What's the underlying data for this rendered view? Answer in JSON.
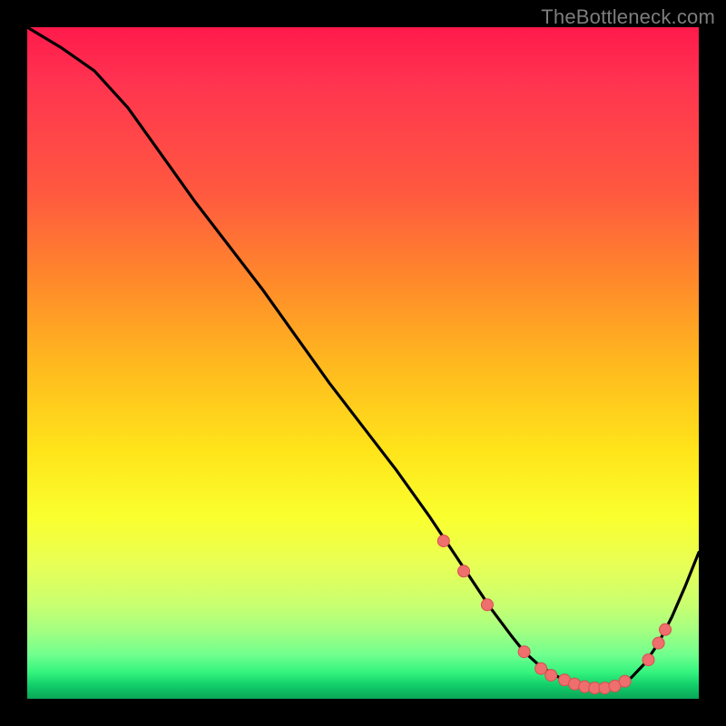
{
  "watermark": "TheBottleneck.com",
  "colors": {
    "curve": "#000000",
    "marker_fill": "#ef6e6e",
    "marker_stroke": "#d74f4f",
    "background": "#000000"
  },
  "chart_data": {
    "type": "line",
    "title": "",
    "xlabel": "",
    "ylabel": "",
    "xlim": [
      0,
      100
    ],
    "ylim": [
      0,
      100
    ],
    "grid": false,
    "legend": false,
    "series": [
      {
        "name": "bottleneck-curve",
        "x": [
          0,
          5,
          10,
          15,
          20,
          25,
          30,
          35,
          40,
          45,
          50,
          55,
          60,
          63,
          66,
          69,
          72,
          74,
          76,
          78,
          80,
          82,
          84,
          86,
          88,
          90,
          92,
          94,
          96,
          98,
          100
        ],
        "y": [
          100,
          97,
          93.5,
          88,
          81,
          74,
          67.5,
          61,
          54,
          47,
          40.5,
          34,
          27,
          22.5,
          18,
          13.5,
          9.5,
          7,
          5.2,
          3.8,
          2.8,
          2.0,
          1.6,
          1.6,
          2.0,
          3.2,
          5.3,
          8.3,
          12.2,
          16.8,
          21.8
        ]
      }
    ],
    "markers": {
      "series": "bottleneck-curve",
      "points": [
        {
          "x": 62,
          "y": 23.5
        },
        {
          "x": 65,
          "y": 19
        },
        {
          "x": 68.5,
          "y": 14
        },
        {
          "x": 74,
          "y": 7
        },
        {
          "x": 76.5,
          "y": 4.5
        },
        {
          "x": 78,
          "y": 3.5
        },
        {
          "x": 80,
          "y": 2.8
        },
        {
          "x": 81.5,
          "y": 2.2
        },
        {
          "x": 83,
          "y": 1.8
        },
        {
          "x": 84.5,
          "y": 1.6
        },
        {
          "x": 86,
          "y": 1.6
        },
        {
          "x": 87.5,
          "y": 1.9
        },
        {
          "x": 89,
          "y": 2.6
        },
        {
          "x": 92.5,
          "y": 5.8
        },
        {
          "x": 94,
          "y": 8.3
        },
        {
          "x": 95,
          "y": 10.3
        }
      ]
    }
  }
}
